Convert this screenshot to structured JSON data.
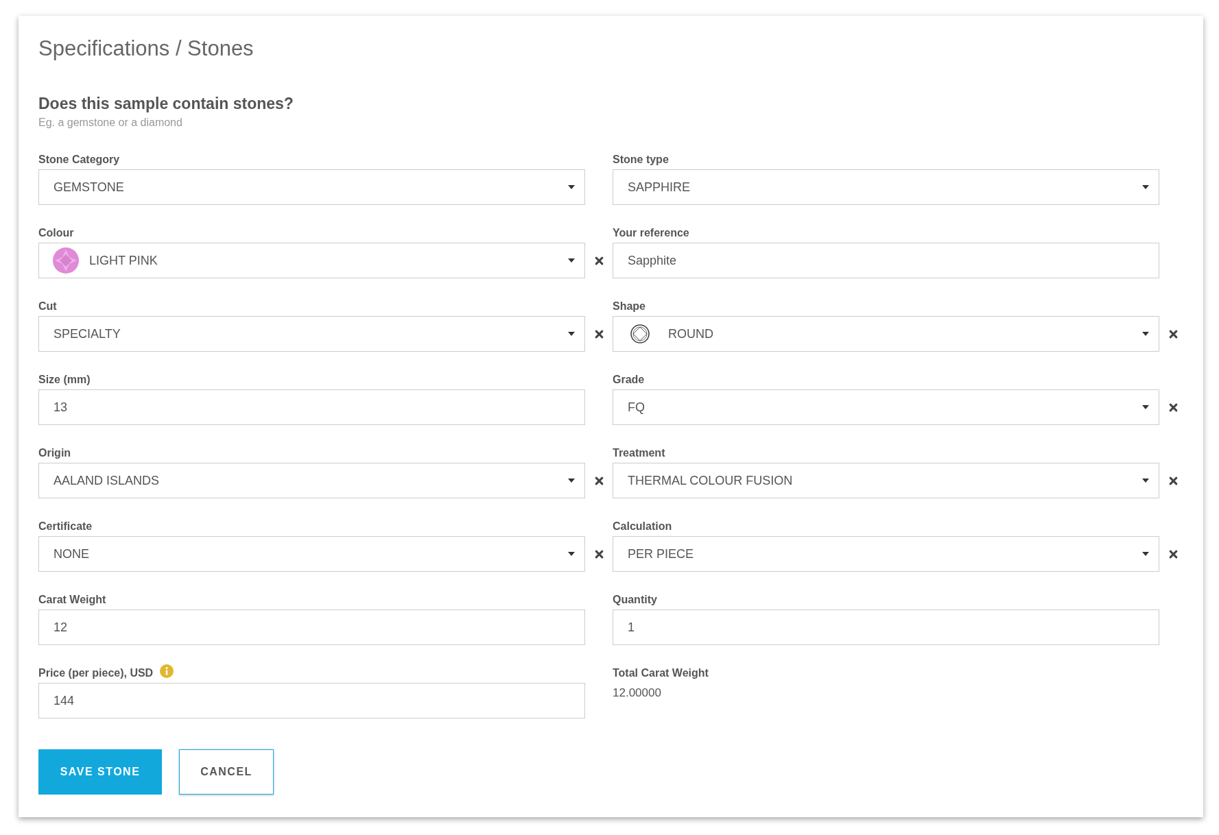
{
  "breadcrumb": "Specifications / Stones",
  "question": "Does this sample contain stones?",
  "hint": "Eg. a gemstone or a diamond",
  "fields": [
    {
      "label": "Stone Category",
      "kind": "select",
      "value": "GEMSTONE",
      "clearable": false
    },
    {
      "label": "Stone type",
      "kind": "select",
      "value": "SAPPHIRE",
      "clearable": false
    },
    {
      "label": "Colour",
      "kind": "swatch-select",
      "value": "LIGHT PINK",
      "color": "#e08ad8",
      "clearable": true
    },
    {
      "label": "Your reference",
      "kind": "input",
      "value": "Sapphite",
      "clearable": false
    },
    {
      "label": "Cut",
      "kind": "select",
      "value": "SPECIALTY",
      "clearable": true
    },
    {
      "label": "Shape",
      "kind": "shape-select",
      "value": "ROUND",
      "clearable": true
    },
    {
      "label": "Size (mm)",
      "kind": "input",
      "value": "13",
      "clearable": false
    },
    {
      "label": "Grade",
      "kind": "select",
      "value": "FQ",
      "clearable": true
    },
    {
      "label": "Origin",
      "kind": "select",
      "value": "AALAND ISLANDS",
      "clearable": true
    },
    {
      "label": "Treatment",
      "kind": "select",
      "value": "THERMAL COLOUR FUSION",
      "clearable": true
    },
    {
      "label": "Certificate",
      "kind": "select",
      "value": "NONE",
      "clearable": true
    },
    {
      "label": "Calculation",
      "kind": "select",
      "value": "PER PIECE",
      "clearable": true
    },
    {
      "label": "Carat Weight",
      "kind": "input",
      "value": "12",
      "clearable": false
    },
    {
      "label": "Quantity",
      "kind": "input",
      "value": "1",
      "clearable": false
    },
    {
      "label": "Price (per piece), USD",
      "kind": "input",
      "value": "144",
      "clearable": false,
      "info": true
    },
    {
      "label": "Total Carat Weight",
      "kind": "readout",
      "value": "12.00000",
      "clearable": false
    }
  ],
  "buttons": [
    {
      "label": "SAVE STONE",
      "kind": "primary"
    },
    {
      "label": "CANCEL",
      "kind": "secondary"
    }
  ]
}
